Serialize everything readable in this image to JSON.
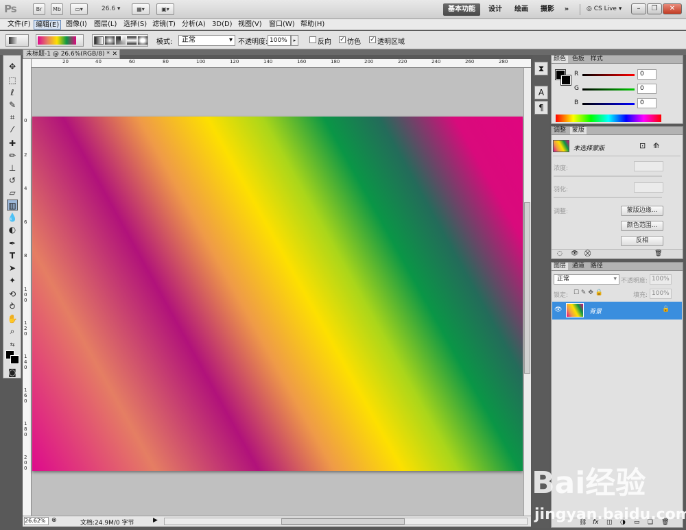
{
  "appbar": {
    "logo": "Ps",
    "br": "Br",
    "mb": "Mb",
    "zoom": "26.6",
    "workspaces": [
      "基本功能",
      "设计",
      "绘画",
      "摄影"
    ],
    "more": "»",
    "cs_live": "CS Live"
  },
  "menu": [
    "文件(F)",
    "编辑(E)",
    "图像(I)",
    "图层(L)",
    "选择(S)",
    "滤镜(T)",
    "分析(A)",
    "3D(D)",
    "视图(V)",
    "窗口(W)",
    "帮助(H)"
  ],
  "options": {
    "mode_label": "模式:",
    "mode_value": "正常",
    "opacity_label": "不透明度:",
    "opacity_value": "100%",
    "reverse": "反向",
    "dither": "仿色",
    "transparency": "透明区域"
  },
  "document": {
    "tab_title": "未标题-1 @ 26.6%(RGB/8) *",
    "ruler_top": [
      "20",
      "40",
      "60",
      "80",
      "100",
      "120",
      "140",
      "160",
      "180",
      "200",
      "220",
      "240",
      "260",
      "280"
    ],
    "ruler_left": [
      "0",
      "2",
      "4",
      "6",
      "8",
      "100",
      "120",
      "140",
      "160",
      "180",
      "200"
    ],
    "zoom": "26.62%",
    "doc_info": "文档:24.9M/0 字节"
  },
  "color_panel": {
    "tabs": [
      "颜色",
      "色板",
      "样式"
    ],
    "r_label": "R",
    "g_label": "G",
    "b_label": "B",
    "r": "0",
    "g": "0",
    "b": "0"
  },
  "masks_panel": {
    "tabs": [
      "调整",
      "蒙版"
    ],
    "no_mask": "未选择蒙版",
    "density": "浓度:",
    "feather": "羽化:",
    "refine": "调整:",
    "mask_edge": "蒙版边缘...",
    "color_range": "颜色范围...",
    "invert": "反相"
  },
  "layers_panel": {
    "tabs": [
      "图层",
      "通道",
      "路径"
    ],
    "blend": "正常",
    "opacity_label": "不透明度:",
    "opacity": "100%",
    "lock_label": "锁定:",
    "fill_label": "填充:",
    "fill": "100%",
    "layer_name": "背景"
  },
  "watermark": {
    "text": "Bai经验",
    "url": "jingyan.baidu.com"
  },
  "colors": {
    "accent": "#3a8ede",
    "ui_bg": "#e1e1e1"
  }
}
